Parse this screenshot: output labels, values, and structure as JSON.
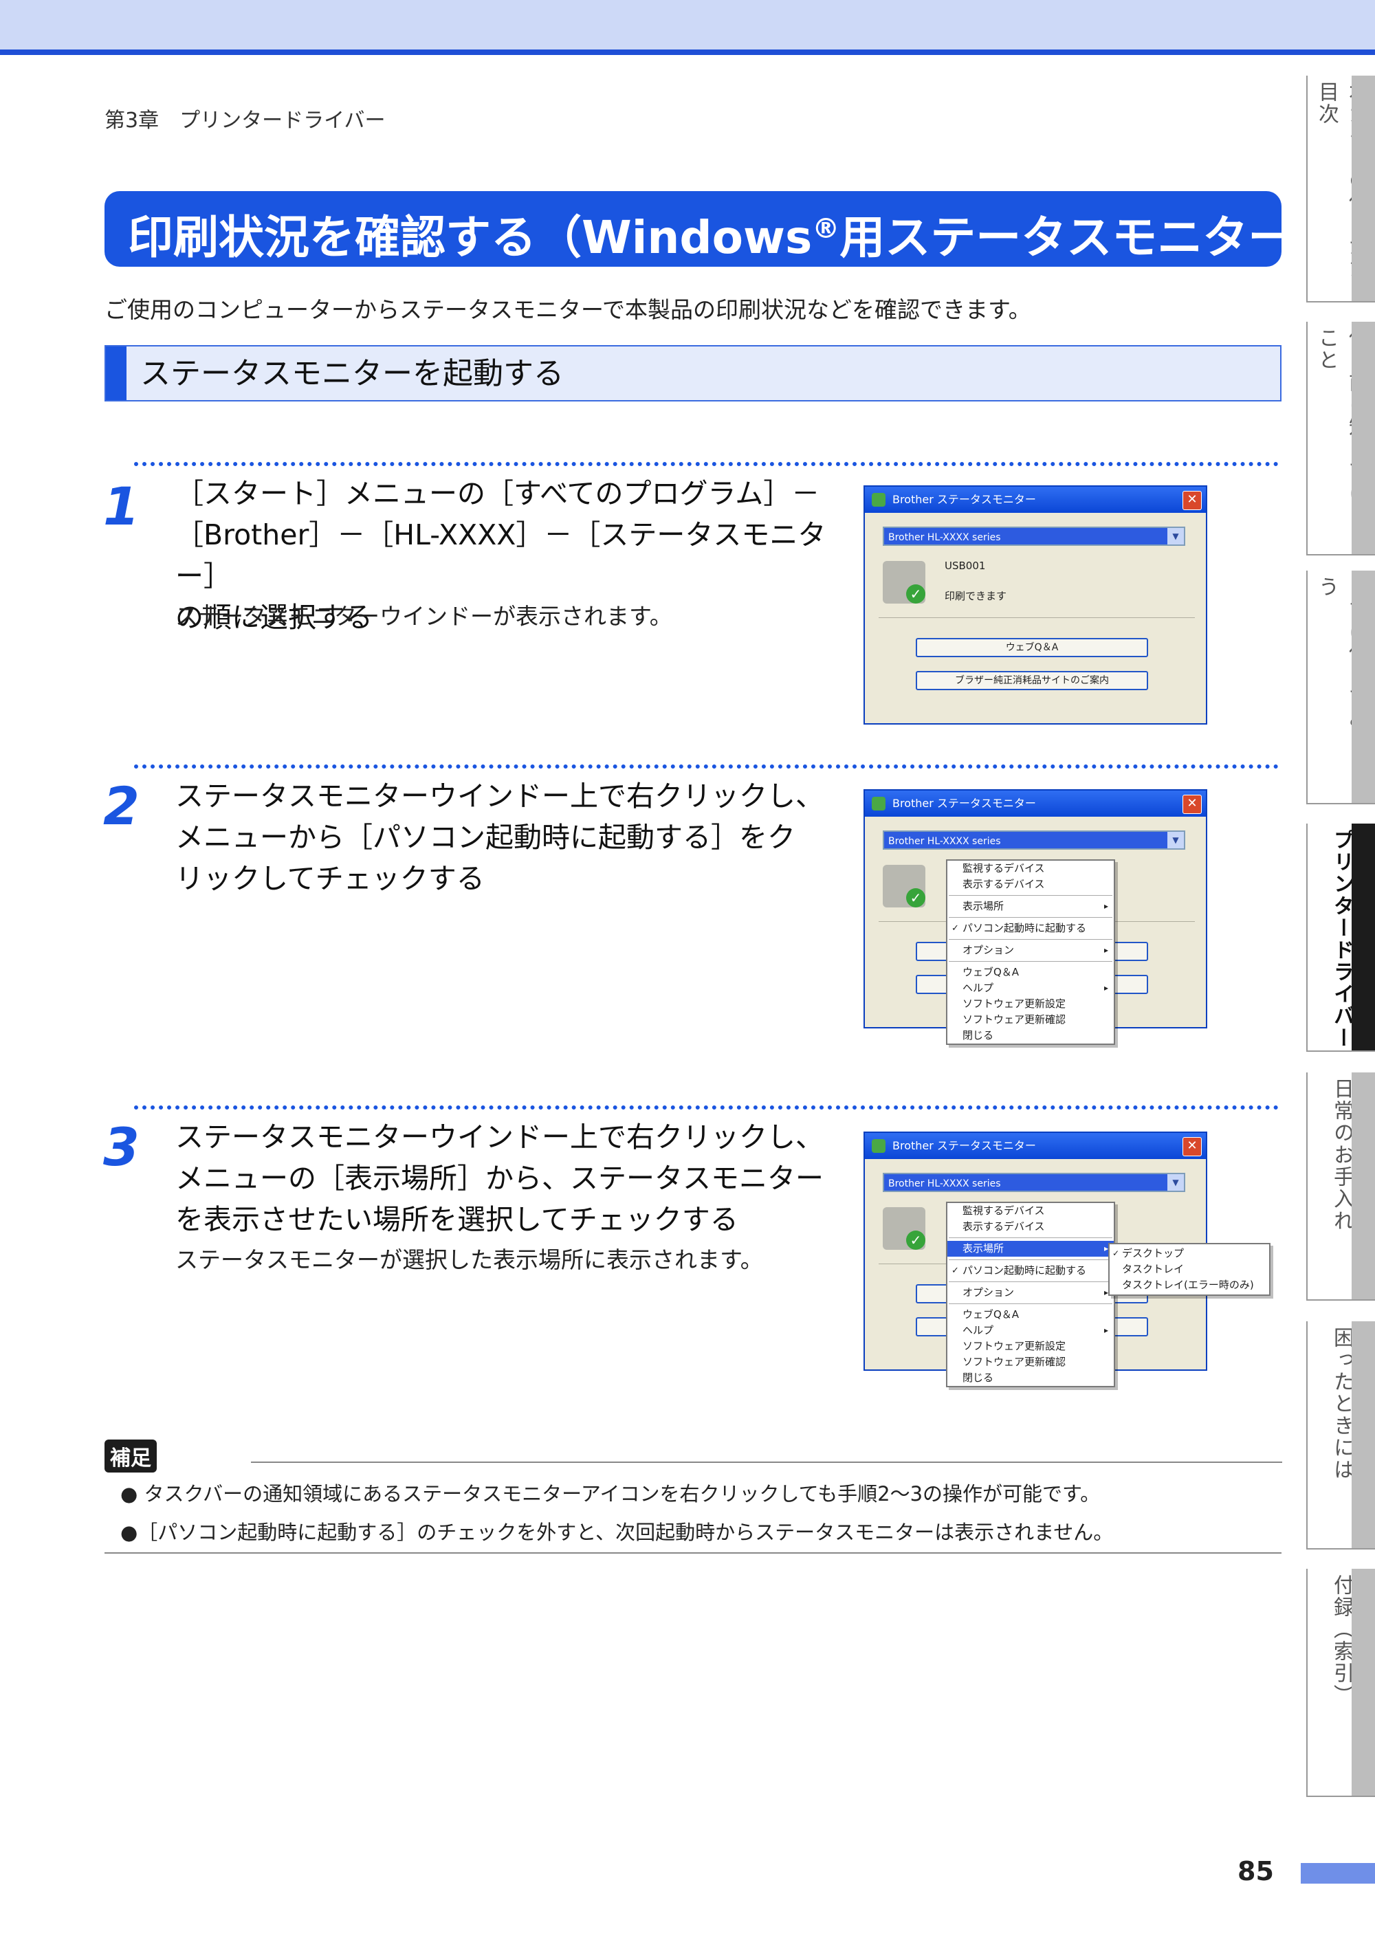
{
  "header": {
    "chapter": "第3章　プリンタードライバー"
  },
  "title": {
    "main": "印刷状況を確認する（Windows",
    "reg": "®",
    "rest": "用ステータスモニター）"
  },
  "intro": "ご使用のコンピューターからステータスモニターで本製品の印刷状況などを確認できます。",
  "section": {
    "title": "ステータスモニターを起動する"
  },
  "steps": [
    {
      "number": "1",
      "lines": [
        "［スタート］メニューの［すべてのプログラム］－",
        "［Brother］－［HL-XXXX］－［ステータスモニター］",
        "の順に選択する"
      ],
      "sub": "ステータスモニターウインドーが表示されます。"
    },
    {
      "number": "2",
      "lines": [
        "ステータスモニターウインドー上で右クリックし、",
        "メニューから［パソコン起動時に起動する］をク",
        "リックしてチェックする"
      ],
      "sub": ""
    },
    {
      "number": "3",
      "lines": [
        "ステータスモニターウインドー上で右クリックし、",
        "メニューの［表示場所］から、ステータスモニター",
        "を表示させたい場所を選択してチェックする"
      ],
      "sub": "ステータスモニターが選択した表示場所に表示されます。"
    }
  ],
  "window": {
    "title": "Brother ステータスモニター",
    "close": "✕",
    "device": "Brother HL-XXXX series",
    "dropdown_arrow": "▼",
    "port": "USB001",
    "status": "印刷できます",
    "button1": "ウェブQ＆A",
    "button2": "ブラザー純正消耗品サイトのご案内",
    "check_icon": "✓"
  },
  "menu": {
    "items": [
      "監視するデバイス",
      "表示するデバイス",
      "表示場所",
      "パソコン起動時に起動する",
      "オプション",
      "ウェブQ＆A",
      "ヘルプ",
      "ソフトウェア更新設定",
      "ソフトウェア更新確認",
      "閉じる"
    ]
  },
  "submenu": {
    "items": [
      "デスクトップ",
      "タスクトレイ",
      "タスクトレイ(エラー時のみ)"
    ]
  },
  "note": {
    "badge": "補足",
    "bullets": [
      "● タスクバーの通知領域にあるステータスモニターアイコンを右クリックしても手順2〜3の操作が可能です。",
      "●［パソコン起動時に起動する］のチェックを外すと、次回起動時からステータスモニターは表示されません。"
    ]
  },
  "side_tabs": [
    "本ガイドの使いかた・目次",
    "使う前に知ってほしいこと",
    "まずは使ってみましょう",
    "プリンタードライバー",
    "日常のお手入れ",
    "困ったときには",
    "付録（索引）"
  ],
  "colors": {
    "accent": "#1a55e0",
    "band": "#cdd9f7",
    "active_tab": "#1c1c1c"
  },
  "page_number": "85"
}
